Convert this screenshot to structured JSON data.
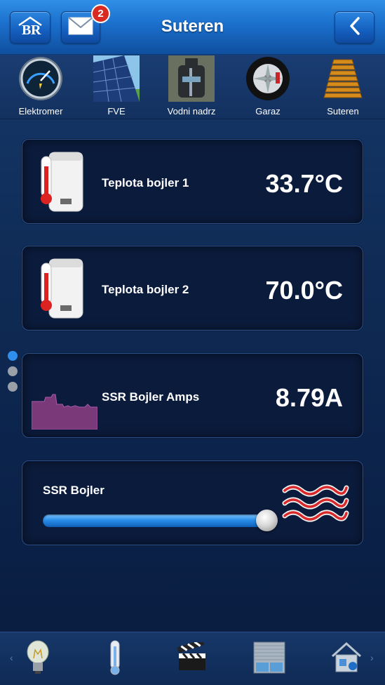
{
  "header": {
    "title": "Suteren",
    "mail_badge": "2",
    "home_icon": "br-logo-home-icon",
    "mail_icon": "envelope-icon",
    "back_icon": "chevron-left-icon"
  },
  "rooms": [
    {
      "label": "Elektromer",
      "icon": "gauge-meter-icon"
    },
    {
      "label": "FVE",
      "icon": "solar-panel-icon"
    },
    {
      "label": "Vodni nadrz",
      "icon": "water-tank-icon"
    },
    {
      "label": "Garaz",
      "icon": "car-wheel-icon"
    },
    {
      "label": "Suteren",
      "icon": "stairs-icon"
    }
  ],
  "cards": {
    "boiler1": {
      "label": "Teplota bojler 1",
      "value": "33.7°C",
      "icon": "boiler-thermometer-icon"
    },
    "boiler2": {
      "label": "Teplota bojler 2",
      "value": "70.0°C",
      "icon": "boiler-thermometer-icon"
    },
    "amps": {
      "label": "SSR Bojler Amps",
      "value": "8.79A",
      "icon": "history-graph-icon"
    },
    "ssr": {
      "label": "SSR Bojler",
      "icon": "heat-waves-icon",
      "slider_level": 1.0
    }
  },
  "page_indicator": {
    "count": 3,
    "active": 0
  },
  "bottom_nav": [
    {
      "icon": "light-bulb-icon"
    },
    {
      "icon": "thermometer-icon"
    },
    {
      "icon": "clapperboard-icon"
    },
    {
      "icon": "window-blinds-icon"
    },
    {
      "icon": "house-settings-icon"
    }
  ],
  "colors": {
    "accent": "#2f8fef",
    "badge": "#d92b22",
    "graph": "#7a3a7a"
  }
}
